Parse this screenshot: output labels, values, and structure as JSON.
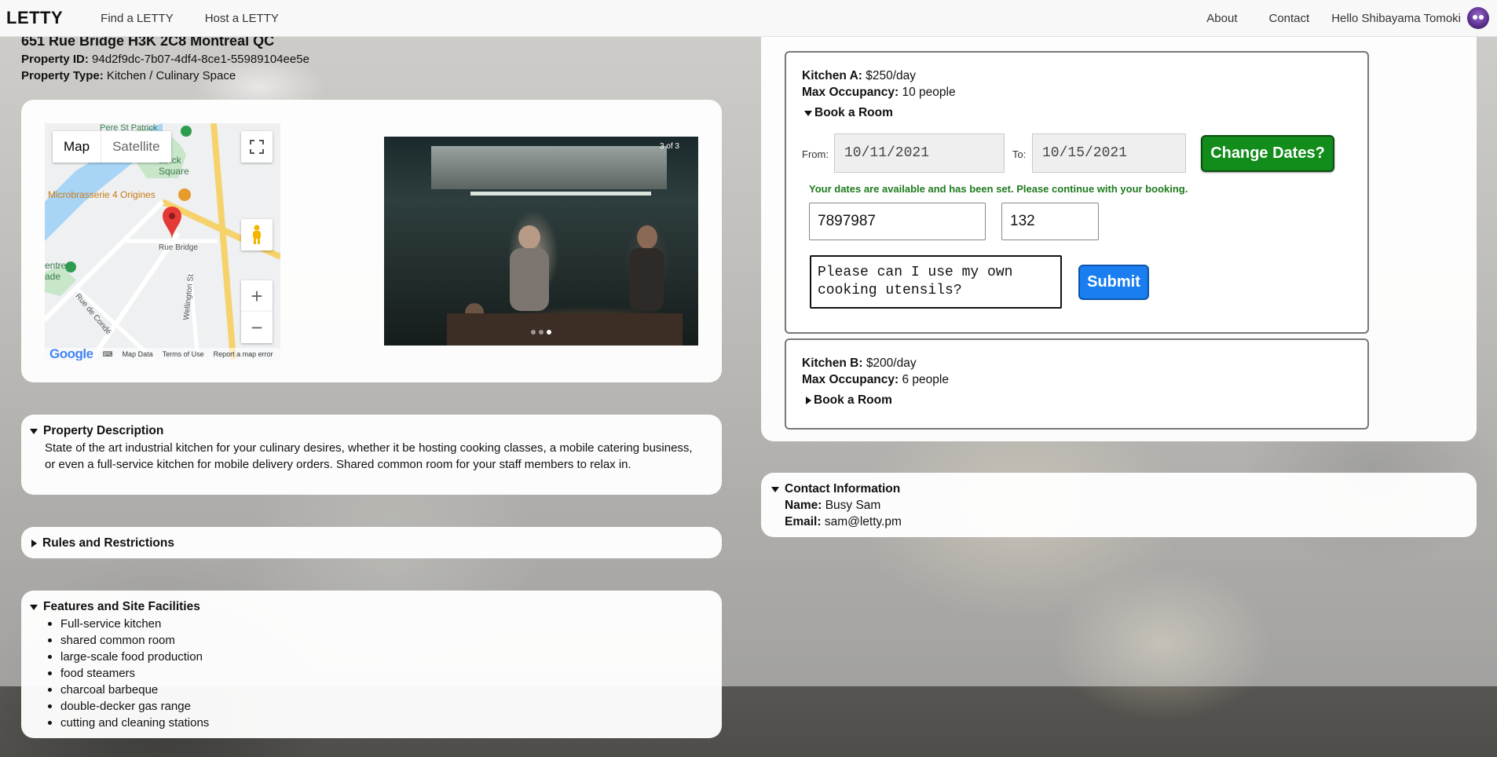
{
  "nav": {
    "brand": "LETTY",
    "find": "Find a LETTY",
    "host": "Host a LETTY",
    "about": "About",
    "contact": "Contact",
    "hello": "Hello Shibayama Tomoki",
    "avatar_icon": "avatar-icon"
  },
  "property": {
    "address": "651 Rue Bridge H3K 2C8 Montreal QC",
    "id_label": "Property ID:",
    "id_value": "94d2f9dc-7b07-4df4-8ce1-55989104ee5e",
    "type_label": "Property Type:",
    "type_value": "Kitchen / Culinary Space"
  },
  "map": {
    "map_tab": "Map",
    "satellite_tab": "Satellite",
    "labels": {
      "poi1": "Pere St Patrick",
      "poi2": "atrick Square",
      "poi3": "Microbrasserie 4 Origines",
      "street1": "Rue Bridge",
      "street2": "Wellington St",
      "street3": "Rue de Condé",
      "poi4": "entre ade"
    },
    "footer": {
      "google": "Google",
      "map_data": "Map Data",
      "terms": "Terms of Use",
      "report": "Report a map error"
    },
    "zoom_in": "+",
    "zoom_out": "−"
  },
  "carousel": {
    "counter": "3 of 3",
    "total_slides": 3,
    "active_slide": 2
  },
  "description": {
    "title": "Property Description",
    "text": "State of the art industrial kitchen for your culinary desires, whether it be hosting cooking classes, a mobile catering business, or even a full-service kitchen for mobile delivery orders. Shared common room for your staff members to relax in."
  },
  "rules": {
    "title": "Rules and Restrictions"
  },
  "features": {
    "title": "Features and Site Facilities",
    "items": [
      "Full-service kitchen",
      "shared common room",
      "large-scale food production",
      "food steamers",
      "charcoal barbeque",
      "double-decker gas range",
      "cutting and cleaning stations"
    ]
  },
  "kitchens": {
    "a": {
      "name_label": "Kitchen A:",
      "price": "$250/day",
      "occ_label": "Max Occupancy:",
      "occ_value": "10 people",
      "book": "Book a Room",
      "from_label": "From:",
      "from_value": "10/11/2021",
      "to_label": "To:",
      "to_value": "10/15/2021",
      "change_btn": "Change Dates?",
      "available_msg": "Your dates are available and has been set. Please continue with your booking.",
      "field1": "7897987",
      "field2": "132",
      "message": "Please can I use my own cooking utensils?",
      "submit": "Submit"
    },
    "b": {
      "name_label": "Kitchen B:",
      "price": "$200/day",
      "occ_label": "Max Occupancy:",
      "occ_value": "6 people",
      "book": "Book a Room"
    }
  },
  "contact_info": {
    "title": "Contact Information",
    "name_label": "Name:",
    "name_value": "Busy Sam",
    "email_label": "Email:",
    "email_value": "sam@letty.pm"
  }
}
